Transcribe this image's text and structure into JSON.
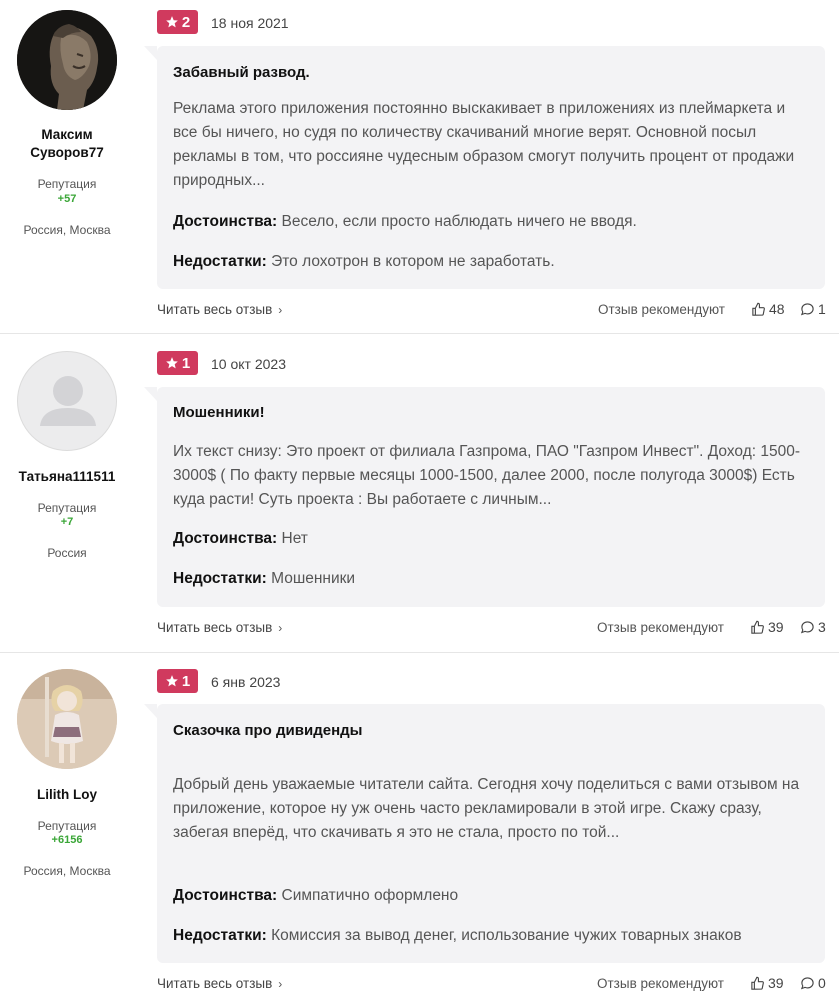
{
  "labels": {
    "reputation": "Репутация",
    "pros": "Достоинства:",
    "cons": "Недостатки:",
    "read_more": "Читать весь отзыв",
    "recommend": "Отзыв рекомендуют"
  },
  "reviews": [
    {
      "user": {
        "name_line1": "Максим",
        "name_line2": "Суворов77",
        "reputation": "+57",
        "location": "Россия, Москва",
        "avatar": "statue-photo"
      },
      "rating": "2",
      "date": "18 ноя 2021",
      "title": "Забавный развод.",
      "text": "Реклама этого приложения постоянно выскакивает в приложениях из плеймаркета и все бы ничего, но судя по количеству скачиваний многие верят. Основной посыл рекламы в том, что россияне чудесным образом смогут получить процент от продажи природных...",
      "pros": "Весело, если просто наблюдать ничего не вводя.",
      "cons": "Это лохотрон в котором не заработать.",
      "likes": "48",
      "comments": "1"
    },
    {
      "user": {
        "name_line1": "Татьяна111511",
        "name_line2": "",
        "reputation": "+7",
        "location": "Россия",
        "avatar": "default-avatar"
      },
      "rating": "1",
      "date": "10 окт 2023",
      "title": "Мошенники!",
      "text": "Их текст снизу: Это проект от филиала Газпрома, ПАО \"Газпром Инвест\". Доход: 1500- 3000$ ( По факту первые месяцы 1000-1500, далее 2000, после полугода 3000$) Есть куда расти! Суть проекта : Вы работаете с личным...",
      "pros": "Нет",
      "cons": "Мошенники",
      "likes": "39",
      "comments": "3"
    },
    {
      "user": {
        "name_line1": "Lilith Loy",
        "name_line2": "",
        "reputation": "+6156",
        "location": "Россия, Москва",
        "avatar": "doll-photo"
      },
      "rating": "1",
      "date": "6 янв 2023",
      "title": "Сказочка про дивиденды",
      "text": "Добрый день уважаемые читатели сайта. Сегодня хочу поделиться с вами отзывом на приложение, которое ну уж очень часто рекламировали в этой игре. Скажу сразу, забегая вперёд, что скачивать я это не стала, просто по той...",
      "pros": "Симпатично оформлено",
      "cons": "Комиссия за вывод денег, использование чужих товарных знаков",
      "likes": "39",
      "comments": "0"
    }
  ],
  "colors": {
    "rating_badge": "#d03a5e",
    "reputation": "#3aa637",
    "bubble": "#f3f3f5"
  }
}
